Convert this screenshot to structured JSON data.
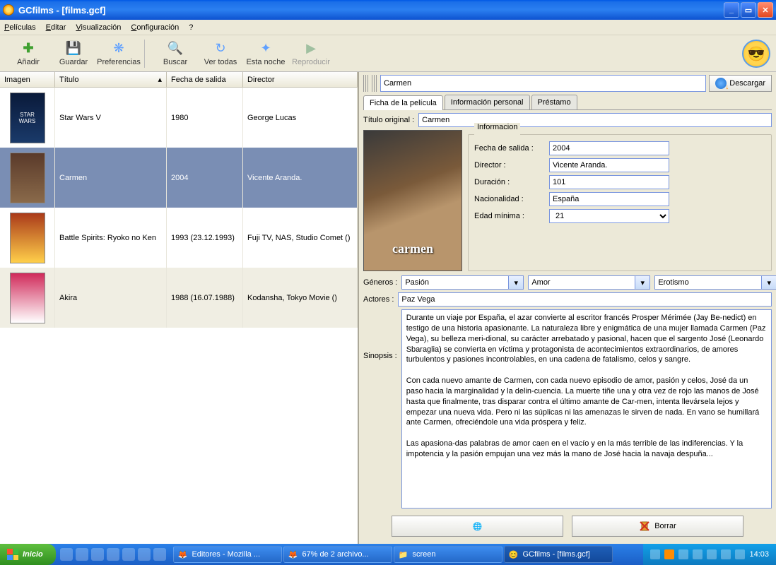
{
  "window": {
    "title": "GCfilms - [films.gcf]"
  },
  "menu": {
    "peliculas": "Películas",
    "editar": "Editar",
    "visualizacion": "Visualización",
    "configuracion": "Configuración",
    "help": "?"
  },
  "toolbar": {
    "anadir": "Añadir",
    "guardar": "Guardar",
    "preferencias": "Preferencias",
    "buscar": "Buscar",
    "ver_todas": "Ver todas",
    "esta_noche": "Esta noche",
    "reproducir": "Reproducir"
  },
  "columns": {
    "imagen": "Imagen",
    "titulo": "Título",
    "fecha": "Fecha de salida",
    "director": "Director"
  },
  "films": [
    {
      "title": "Star Wars V",
      "year": "1980",
      "director": "George Lucas",
      "thumb": "STAR WARS"
    },
    {
      "title": "Carmen",
      "year": "2004",
      "director": "Vicente Aranda.",
      "thumb": ""
    },
    {
      "title": "Battle Spirits: Ryoko no Ken",
      "year": "1993 (23.12.1993)",
      "director": "Fuji TV, NAS, Studio Comet ()",
      "thumb": ""
    },
    {
      "title": "Akira",
      "year": "1988 (16.07.1988)",
      "director": "Kodansha, Tokyo Movie ()",
      "thumb": ""
    }
  ],
  "detail": {
    "title_value": "Carmen",
    "download": "Descargar",
    "tabs": {
      "ficha": "Ficha de la película",
      "personal": "Información personal",
      "prestamo": "Préstamo"
    },
    "labels": {
      "titulo_original": "Título original :",
      "informacion": "Informacion",
      "fecha": "Fecha de salida :",
      "director": "Director :",
      "duracion": "Duración :",
      "nacionalidad": "Nacionalidad :",
      "edad": "Edad mínima :",
      "generos": "Géneros :",
      "actores": "Actores :",
      "sinopsis": "Sinopsis :",
      "borrar": "Borrar"
    },
    "values": {
      "titulo_original": "Carmen",
      "fecha": "2004",
      "director": "Vicente Aranda.",
      "duracion": "101",
      "nacionalidad": "España",
      "edad": "21",
      "genero1": "Pasión",
      "genero2": "Amor",
      "genero3": "Erotismo",
      "actores": "Paz Vega",
      "poster": "carmen",
      "sinopsis": "Durante un viaje por España, el azar convierte al escritor francés Prosper Mérimée (Jay Be-nedict) en testigo de una historia apasionante. La naturaleza libre y enigmática de una mujer llamada Carmen (Paz Vega), su belleza meri-dional, su carácter arrebatado y pasional, hacen que el sargento José (Leonardo Sbaraglia) se convierta en víctima y protagonista de acontecimientos extraordinarios, de amores turbulentos y pasiones incontrolables, en una cadena de fatalismo, celos y sangre.\n\nCon cada nuevo amante de Carmen, con cada nuevo episodio de amor, pasión y celos, José da un paso hacia la marginalidad y la delin-cuencia. La muerte tiñe una y otra vez de rojo las manos de José hasta que finalmente, tras disparar contra el último amante de Car-men, intenta llevársela lejos y empezar una nueva vida. Pero ni las súplicas ni las amenazas le sirven de nada. En vano se humillará ante Carmen, ofreciéndole una vida próspera y feliz.\n\nLas apasiona-das palabras de amor caen en el vacío y en la más terrible de las indiferencias. Y la impotencia y la pasión empujan una vez más la mano de José hacia la navaja despuña..."
    }
  },
  "taskbar": {
    "start": "Inicio",
    "items": [
      "Editores - Mozilla ...",
      "67% de 2 archivo...",
      "screen",
      "GCfilms - [films.gcf]"
    ],
    "clock": "14:03"
  }
}
